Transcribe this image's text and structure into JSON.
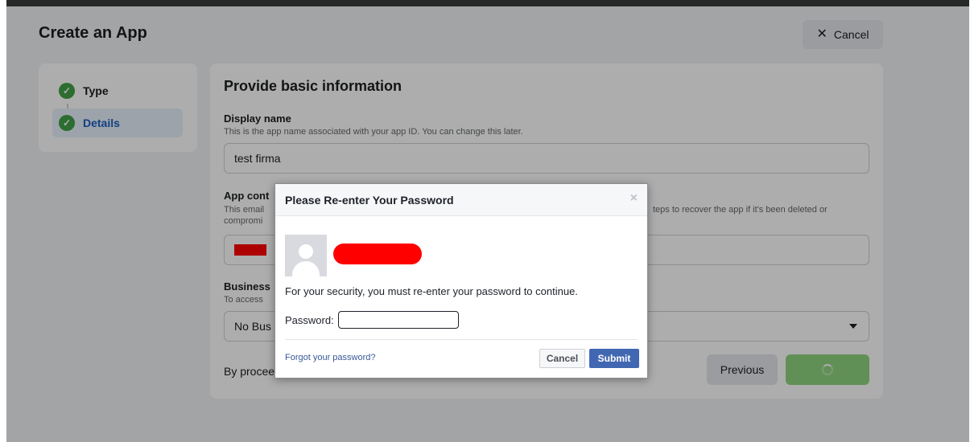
{
  "header": {
    "title": "Create an App",
    "cancel_label": "Cancel"
  },
  "steps": {
    "items": [
      {
        "label": "Type",
        "state": "complete"
      },
      {
        "label": "Details",
        "state": "active"
      }
    ]
  },
  "form": {
    "section_title": "Provide basic information",
    "display_name": {
      "label": "Display name",
      "help": "This is the app name associated with your app ID. You can change this later.",
      "value": "test firma"
    },
    "app_contact": {
      "label": "App cont",
      "help_line1": "This email",
      "help_line2": "compromi",
      "help_right": "teps to recover the app if it's been deleted or"
    },
    "business": {
      "label": "Business",
      "help": "To access",
      "value": "No Bus"
    },
    "consent_text": "By procee",
    "previous_label": "Previous"
  },
  "dialog": {
    "title": "Please Re-enter Your Password",
    "close_glyph": "×",
    "message": "For your security, you must re-enter your password to continue.",
    "password_label": "Password:",
    "password_value": "",
    "forgot_link": "Forgot your password?",
    "cancel_label": "Cancel",
    "submit_label": "Submit"
  },
  "colors": {
    "accent_blue": "#4267b2",
    "success_green": "#42a147",
    "primary_button_green": "#8ed47e",
    "redaction_red": "#ff0000"
  }
}
